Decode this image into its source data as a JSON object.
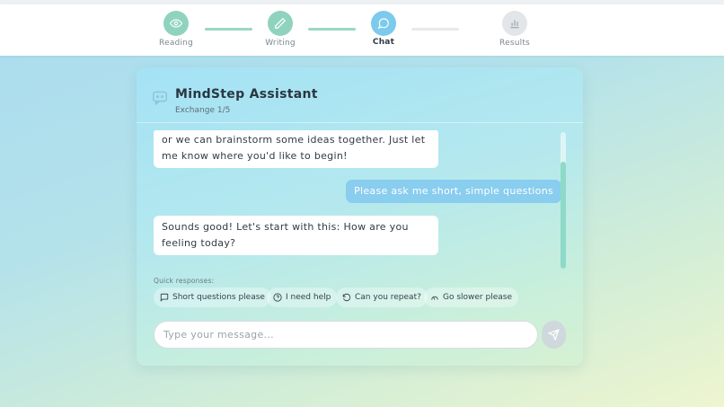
{
  "stepper": {
    "steps": [
      {
        "label": "Reading",
        "state": "done",
        "icon": "eye-icon"
      },
      {
        "label": "Writing",
        "state": "done",
        "icon": "pencil-icon"
      },
      {
        "label": "Chat",
        "state": "current",
        "icon": "chat-bubble-icon"
      },
      {
        "label": "Results",
        "state": "pending",
        "icon": "bar-chart-icon"
      }
    ]
  },
  "chat": {
    "title": "MindStep Assistant",
    "exchange": "Exchange 1/5",
    "messages": [
      {
        "role": "assistant",
        "text": "or we can brainstorm some ideas together. Just let me know where you'd like to begin!"
      },
      {
        "role": "user",
        "text": "Please ask me short, simple questions"
      },
      {
        "role": "assistant",
        "text": "Sounds good! Let's start with this: How are you feeling today?"
      }
    ],
    "quick_label": "Quick responses:",
    "quick_responses": [
      {
        "label": "Short questions please",
        "icon": "message-square-icon"
      },
      {
        "label": "I need help",
        "icon": "help-circle-icon"
      },
      {
        "label": "Can you repeat?",
        "icon": "rotate-ccw-icon"
      },
      {
        "label": "Go slower please",
        "icon": "slow-icon"
      }
    ],
    "input_placeholder": "Type your message...",
    "input_value": ""
  },
  "colors": {
    "done": "#8fd3be",
    "current": "#7ccaec",
    "pending": "#e3e6e8",
    "user_bubble": "#89cdef",
    "send_disabled": "#cfd8dc"
  }
}
